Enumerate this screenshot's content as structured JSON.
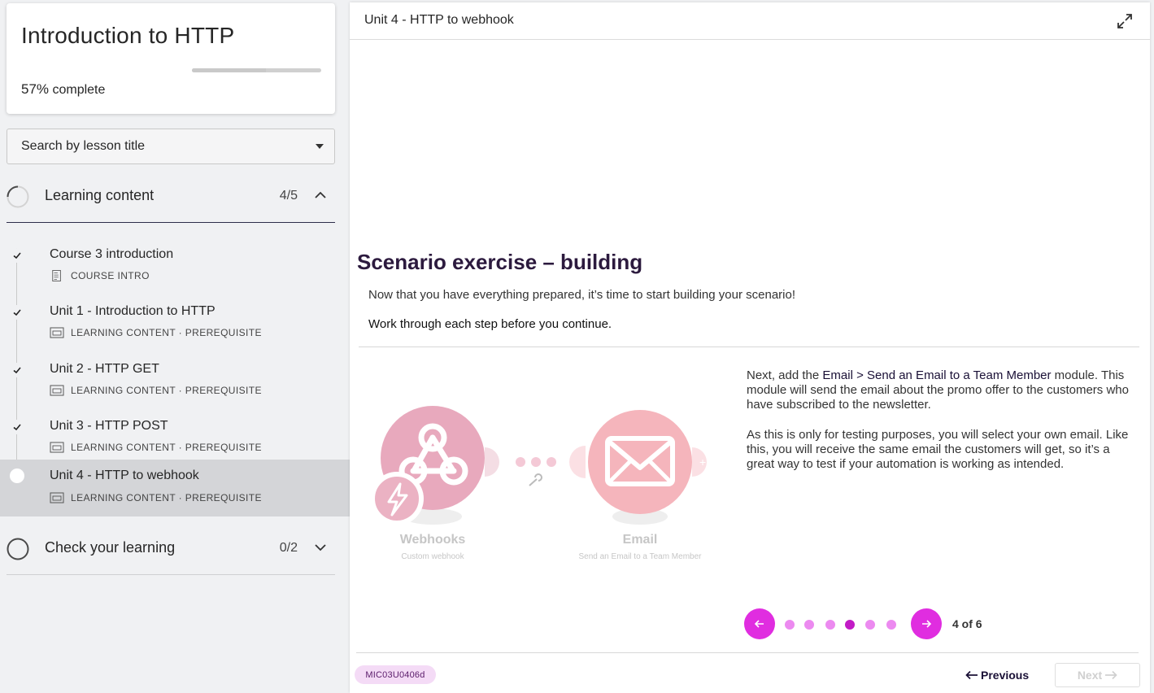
{
  "course": {
    "title": "Introduction to HTTP",
    "progress_percent": 57,
    "progress_value": "57%",
    "progress_suffix": " complete"
  },
  "search": {
    "label": "Search by lesson title"
  },
  "sections": [
    {
      "title": "Learning content",
      "count": "4/5",
      "expanded": true,
      "lessons": [
        {
          "title": "Course 3 introduction",
          "meta": "COURSE INTRO",
          "done": true,
          "icon": "document-icon"
        },
        {
          "title": "Unit 1 - Introduction to HTTP",
          "meta": "LEARNING CONTENT · PREREQUISITE",
          "done": true,
          "icon": "screen-icon"
        },
        {
          "title": "Unit 2 - HTTP GET",
          "meta": "LEARNING CONTENT · PREREQUISITE",
          "done": true,
          "icon": "screen-icon"
        },
        {
          "title": "Unit 3 - HTTP POST",
          "meta": "LEARNING CONTENT · PREREQUISITE",
          "done": true,
          "icon": "screen-icon"
        },
        {
          "title": "Unit 4 - HTTP to webhook",
          "meta": "LEARNING CONTENT · PREREQUISITE",
          "done": false,
          "active": true,
          "icon": "screen-icon"
        }
      ]
    },
    {
      "title": "Check your learning",
      "count": "0/2",
      "expanded": false
    }
  ],
  "main": {
    "unit_title": "Unit 4 - HTTP to webhook",
    "heading": "Scenario exercise – building",
    "intro": "Now that you have everything prepared, it’s time to start building your scenario!",
    "instruction": "Work through each step before you continue.",
    "diagram": {
      "module1_name": "Webhooks",
      "module1_sub": "Custom webhook",
      "module2_name": "Email",
      "module2_sub": "Send an Email to a Team Member"
    },
    "para1_pre": "Next, add the ",
    "para1_bold": "Email > Send an Email to a Team Member",
    "para1_post": " module. This module will send the email about the promo offer to the customers who have subscribed to the newsletter.",
    "para2": "As this is only for testing purposes, you will select your own email. Like this, you will receive the same email the customers will get, so it’s a great way to test if your automation is working as intended.",
    "pager": {
      "current": 4,
      "total": 6,
      "label": "4 of 6"
    },
    "code": "MIC03U0406d",
    "prev_label": "Previous",
    "next_label": "Next"
  },
  "colors": {
    "accent": "#e02de0",
    "dot_inactive": "#ec8af0",
    "dot_active": "#c21bc6",
    "module_pink": "#e8a9bd",
    "email_pink": "#f5b5bc"
  }
}
